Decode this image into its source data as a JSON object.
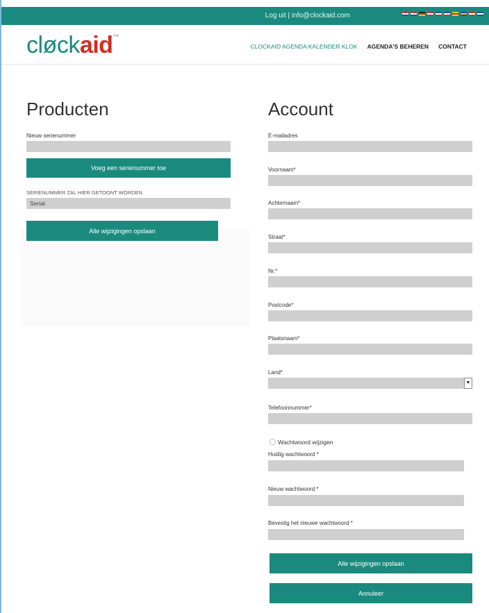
{
  "topbar": {
    "links": "Log uit | info@clockaid.com",
    "flags": [
      [
        "#c0392b",
        "#ffffff",
        "#1f4fa0"
      ],
      [
        "#c0392b",
        "#ffffff",
        "#1f4fa0"
      ],
      [
        "#222222",
        "#c0392b",
        "#f1c40f"
      ],
      [
        "#c0392b",
        "#ffffff",
        "#c0392b"
      ],
      [
        "#1f4fa0",
        "#ffffff",
        "#c0392b"
      ],
      [
        "#1f4fa0",
        "#ffffff",
        "#c0392b"
      ],
      [
        "#f1c40f",
        "#c0392b",
        "#f1c40f"
      ],
      [
        "#1f4fa0",
        "#f1c40f",
        "#1f4fa0"
      ],
      [
        "#c0392b",
        "#ffffff",
        "#c0392b"
      ],
      [
        "#1f4fa0",
        "#ffffff",
        "#1f4fa0"
      ]
    ]
  },
  "logo": {
    "part1": "cløck",
    "part2": "aid",
    "tm": "™"
  },
  "nav": {
    "items": [
      "CLOCKAID AGENDA KALENDER KLOK",
      "AGENDA'S BEHEREN",
      "CONTACT"
    ]
  },
  "products": {
    "heading": "Producten",
    "new_serial_label": "Nieuw serienummer",
    "add_serial_button": "Voeg een serienummer toe",
    "serial_notice": "SERIENUMMER ZAL HIER GETOONT WORDEN",
    "serial_value": "Serial",
    "save_button": "Alle wijzigingen opslaan"
  },
  "account": {
    "heading": "Account",
    "fields": [
      {
        "label": "E-mailadres"
      },
      {
        "label": "Voornaam*"
      },
      {
        "label": "Achternaam*"
      },
      {
        "label": "Straat*"
      },
      {
        "label": "Nr.*"
      },
      {
        "label": "Postcode*"
      },
      {
        "label": "Plaatsnaam*"
      },
      {
        "label": "Land*"
      },
      {
        "label": "Telefoonnummer*"
      }
    ],
    "change_password_label": "Wachtwoord wijzigen",
    "password_fields": [
      {
        "label": "Huidig wachtwoord *"
      },
      {
        "label": "Nieuw wachtwoord *"
      },
      {
        "label": "Bevestig het nieuwe wachtwoord *"
      }
    ],
    "save_button": "Alle wijzigingen opslaan",
    "cancel_button": "Annuleer"
  },
  "colors": {
    "brand_teal": "#1a8a7e",
    "brand_red": "#d62b22",
    "field_gray": "#cfcfcf"
  }
}
